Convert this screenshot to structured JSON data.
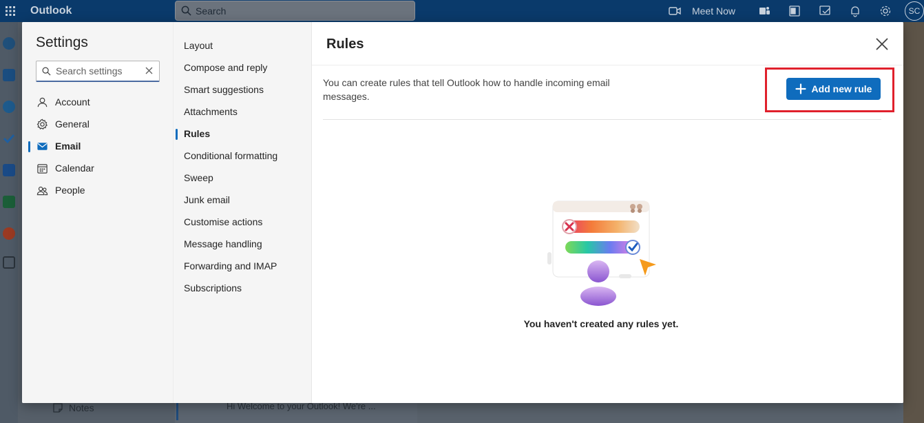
{
  "app": {
    "name": "Outlook"
  },
  "topbar": {
    "search_placeholder": "Search",
    "meet_now": "Meet Now",
    "avatar_initials": "SC"
  },
  "background": {
    "notes_label": "Notes",
    "message_preview": "Hi Welcome to your Outlook! We're ..."
  },
  "settings": {
    "title": "Settings",
    "search_placeholder": "Search settings",
    "categories": [
      {
        "label": "Account",
        "icon": "person-icon"
      },
      {
        "label": "General",
        "icon": "gear-icon"
      },
      {
        "label": "Email",
        "icon": "mail-icon",
        "active": true
      },
      {
        "label": "Calendar",
        "icon": "calendar-icon"
      },
      {
        "label": "People",
        "icon": "people-icon"
      }
    ],
    "email_sections": [
      "Layout",
      "Compose and reply",
      "Smart suggestions",
      "Attachments",
      "Rules",
      "Conditional formatting",
      "Sweep",
      "Junk email",
      "Customise actions",
      "Message handling",
      "Forwarding and IMAP",
      "Subscriptions"
    ],
    "active_section": "Rules"
  },
  "rules": {
    "title": "Rules",
    "description": "You can create rules that tell Outlook how to handle incoming email messages.",
    "add_button": "Add new rule",
    "empty_message": "You haven't created any rules yet."
  },
  "colors": {
    "accent": "#0f6cbd",
    "highlight": "#e0202c",
    "topbar": "#0a3a6b"
  }
}
